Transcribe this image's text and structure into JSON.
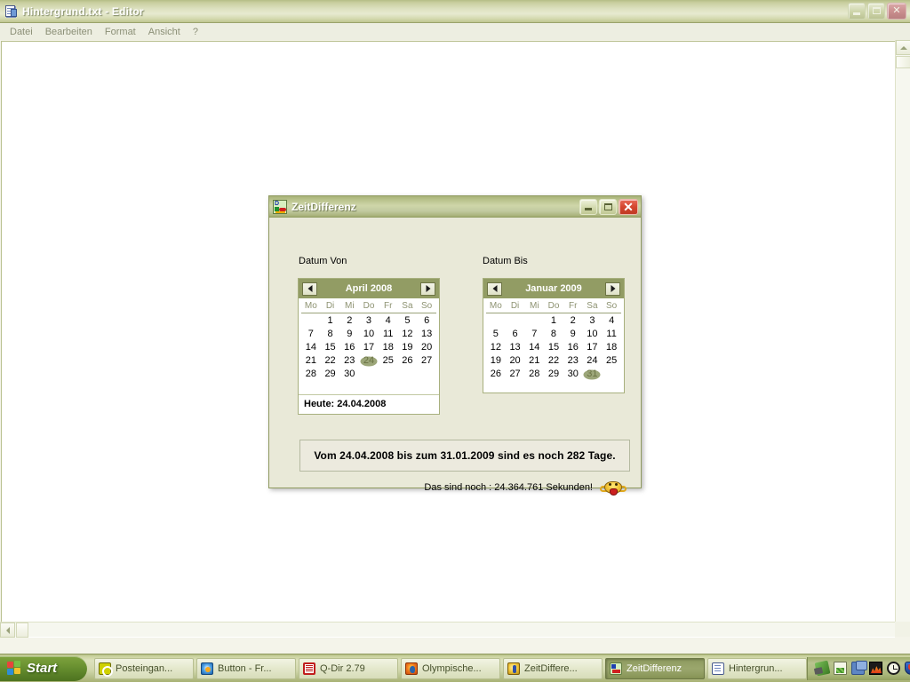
{
  "notepad": {
    "title": "Hintergrund.txt - Editor",
    "icon": "notepad-document-icon",
    "menu": [
      "Datei",
      "Bearbeiten",
      "Format",
      "Ansicht",
      "?"
    ],
    "window_buttons": {
      "minimize": "minimize-icon",
      "maximize": "maximize-icon",
      "close": "close-icon",
      "close_glyph": "✕"
    },
    "document_text": ""
  },
  "dialog": {
    "title": "ZeitDifferenz",
    "icon": "zeitdifferenz-app-icon",
    "window_buttons": {
      "minimize": "minimize-icon",
      "maximize": "maximize-icon",
      "close": "close-icon",
      "close_glyph": "✕"
    },
    "label_from": "Datum Von",
    "label_to": "Datum Bis",
    "calendar_from": {
      "month_label": "April 2008",
      "prev_label": "◄",
      "next_label": "►",
      "weekdays": [
        "Mo",
        "Di",
        "Mi",
        "Do",
        "Fr",
        "Sa",
        "So"
      ],
      "weeks": [
        [
          "",
          "1",
          "2",
          "3",
          "4",
          "5",
          "6"
        ],
        [
          "7",
          "8",
          "9",
          "10",
          "11",
          "12",
          "13"
        ],
        [
          "14",
          "15",
          "16",
          "17",
          "18",
          "19",
          "20"
        ],
        [
          "21",
          "22",
          "23",
          "24",
          "25",
          "26",
          "27"
        ],
        [
          "28",
          "29",
          "30",
          "",
          "",
          "",
          ""
        ]
      ],
      "selected_day": "24",
      "today_label": "Heute:",
      "today_value": "24.04.2008",
      "today_line": "Heute:  24.04.2008"
    },
    "calendar_to": {
      "month_label": "Januar 2009",
      "prev_label": "◄",
      "next_label": "►",
      "weekdays": [
        "Mo",
        "Di",
        "Mi",
        "Do",
        "Fr",
        "Sa",
        "So"
      ],
      "weeks": [
        [
          "",
          "",
          "",
          "1",
          "2",
          "3",
          "4"
        ],
        [
          "5",
          "6",
          "7",
          "8",
          "9",
          "10",
          "11"
        ],
        [
          "12",
          "13",
          "14",
          "15",
          "16",
          "17",
          "18"
        ],
        [
          "19",
          "20",
          "21",
          "22",
          "23",
          "24",
          "25"
        ],
        [
          "26",
          "27",
          "28",
          "29",
          "30",
          "31",
          ""
        ]
      ],
      "selected_day": "31"
    },
    "result_text": "Vom 24.04.2008 bis zum 31.01.2009 sind es noch 282 Tage.",
    "seconds_text": "Das sind noch : 24.364.761 Sekunden!",
    "seconds_icon": "smiley-emoticon-icon"
  },
  "taskbar": {
    "start_label": "Start",
    "start_icon": "windows-flag-icon",
    "items": [
      {
        "label": "Posteingan...",
        "icon": "outlook-icon",
        "active": false
      },
      {
        "label": "Button - Fr...",
        "icon": "button-app-icon",
        "active": false
      },
      {
        "label": "Q-Dir 2.79",
        "icon": "qdir-icon",
        "active": false
      },
      {
        "label": "Olympische...",
        "icon": "firefox-icon",
        "active": false
      },
      {
        "label": "ZeitDiffere...",
        "icon": "zeitdifferenz-doc-icon",
        "active": false
      },
      {
        "label": "ZeitDifferenz",
        "icon": "zeitdifferenz-app-icon",
        "active": true
      },
      {
        "label": "Hintergrun...",
        "icon": "notepad-icon",
        "active": false
      }
    ],
    "tray_icons": [
      "scanner-icon",
      "battery-icon",
      "network-icon",
      "performance-monitor-icon",
      "clock-icon",
      "antivirus-shield-icon"
    ]
  },
  "colors": {
    "titlebar_accent": "#b5bd86",
    "calendar_header": "#929c64",
    "dialog_face": "#e9e9d8",
    "start_green": "#6d9433",
    "selection": "#8b9661"
  }
}
